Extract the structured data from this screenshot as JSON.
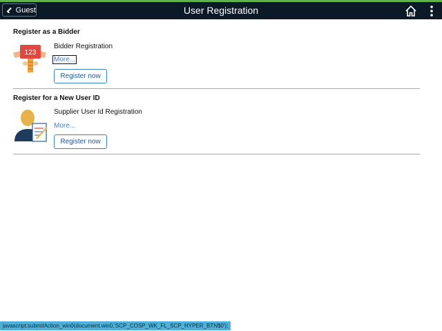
{
  "header": {
    "back_label": "Guest",
    "title": "User Registration",
    "home_icon": "home-icon",
    "menu_icon": "more-vertical-icon"
  },
  "sections": [
    {
      "heading": "Register as a Bidder",
      "illustration_number": "123",
      "item_label": "Bidder Registration",
      "more_label": "More...",
      "button_label": "Register now"
    },
    {
      "heading": "Register for a New User ID",
      "item_label": "Supplier User Id Registration",
      "more_label": "More...",
      "button_label": "Register now"
    }
  ],
  "status_bar": {
    "text": "javascript:submitAction_win0(document.win0,'SCP_COSP_WK_FL_SCP_HYPER_BTN$0');"
  },
  "colors": {
    "header_bg": "#0c1a27",
    "accent": "#5fb34a",
    "link": "#3c7fc1",
    "status_bg": "#4fb0d9"
  }
}
